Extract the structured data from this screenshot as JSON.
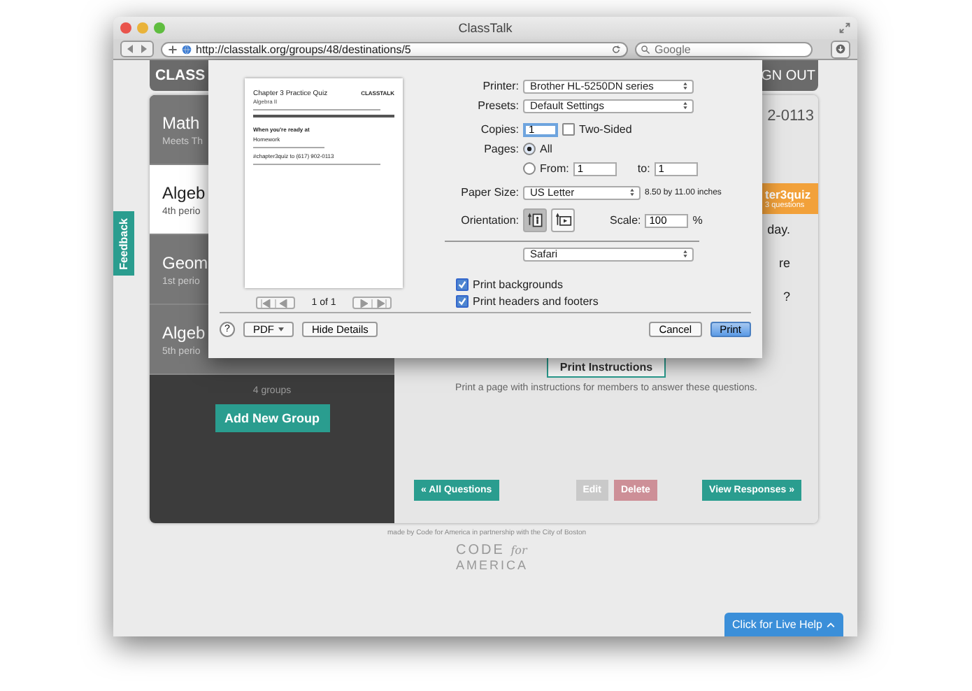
{
  "window": {
    "title": "ClassTalk"
  },
  "toolbar": {
    "url": "http://classtalk.org/groups/48/destinations/5",
    "search": {
      "placeholder": "Google"
    }
  },
  "header": {
    "logo": "CLASS",
    "nav_item": "GN OUT"
  },
  "groups": [
    {
      "name": "Math",
      "detail": "Meets Th",
      "selected": false
    },
    {
      "name": "Algeb",
      "detail": "4th perio",
      "selected": true
    },
    {
      "name": "Geom",
      "detail": "1st perio",
      "selected": false
    },
    {
      "name": "Algeb",
      "detail": "5th perio",
      "selected": false
    }
  ],
  "group_count": "4 groups",
  "add_group_button": "Add New Group",
  "question_panel": {
    "phone": "2-0113",
    "tag": {
      "name": "ter3quiz",
      "count": "3 questions"
    },
    "text_fragments": [
      "day.",
      "re",
      "?"
    ],
    "print_button": "Print Instructions",
    "print_hint": "Print a page with instructions for members to answer these questions.",
    "buttons": [
      {
        "label": "« All Questions",
        "kind": "primary"
      },
      {
        "label": "Edit",
        "kind": "muted"
      },
      {
        "label": "Delete",
        "kind": "danger"
      },
      {
        "label": "View Responses »",
        "kind": "primary"
      }
    ]
  },
  "footer": {
    "credit": "made by Code for America in partnership with the City of Boston",
    "logo_top": "CODE",
    "logo_for": "for",
    "logo_bottom": "AMERICA"
  },
  "feedback_tab": "Feedback",
  "live_help": "Click for Live Help",
  "print_dialog": {
    "preview": {
      "title": "Chapter 3 Practice Quiz",
      "subtitle": "Algebra II",
      "logo": "CLASSTALK",
      "heading": "When you're ready at",
      "value": "Homework",
      "code": "#chapter3quiz to (617) 902-0113"
    },
    "page_indicator": "1 of 1",
    "printer": {
      "label": "Printer:",
      "value": "Brother HL-5250DN series"
    },
    "presets": {
      "label": "Presets:",
      "value": "Default Settings"
    },
    "copies": {
      "label": "Copies:",
      "value": "1"
    },
    "two_sided": {
      "label": "Two-Sided",
      "checked": false
    },
    "pages": {
      "label": "Pages:",
      "options": [
        {
          "label": "All",
          "selected": true
        },
        {
          "label": "From:",
          "selected": false
        }
      ],
      "from": "1",
      "to_label": "to:",
      "to": "1"
    },
    "paper_size": {
      "label": "Paper Size:",
      "value": "US Letter",
      "dimensions": "8.50 by 11.00 inches"
    },
    "orientation": {
      "label": "Orientation:",
      "options": [
        {
          "kind": "portrait",
          "selected": true
        },
        {
          "kind": "landscape",
          "selected": false
        }
      ]
    },
    "scale": {
      "label": "Scale:",
      "value": "100",
      "unit": "%"
    },
    "section": "Safari",
    "options": [
      {
        "label": "Print backgrounds",
        "checked": true
      },
      {
        "label": "Print headers and footers",
        "checked": true
      }
    ],
    "help": "?",
    "pdf": "PDF",
    "hide_details": "Hide Details",
    "cancel": "Cancel",
    "print": "Print"
  }
}
